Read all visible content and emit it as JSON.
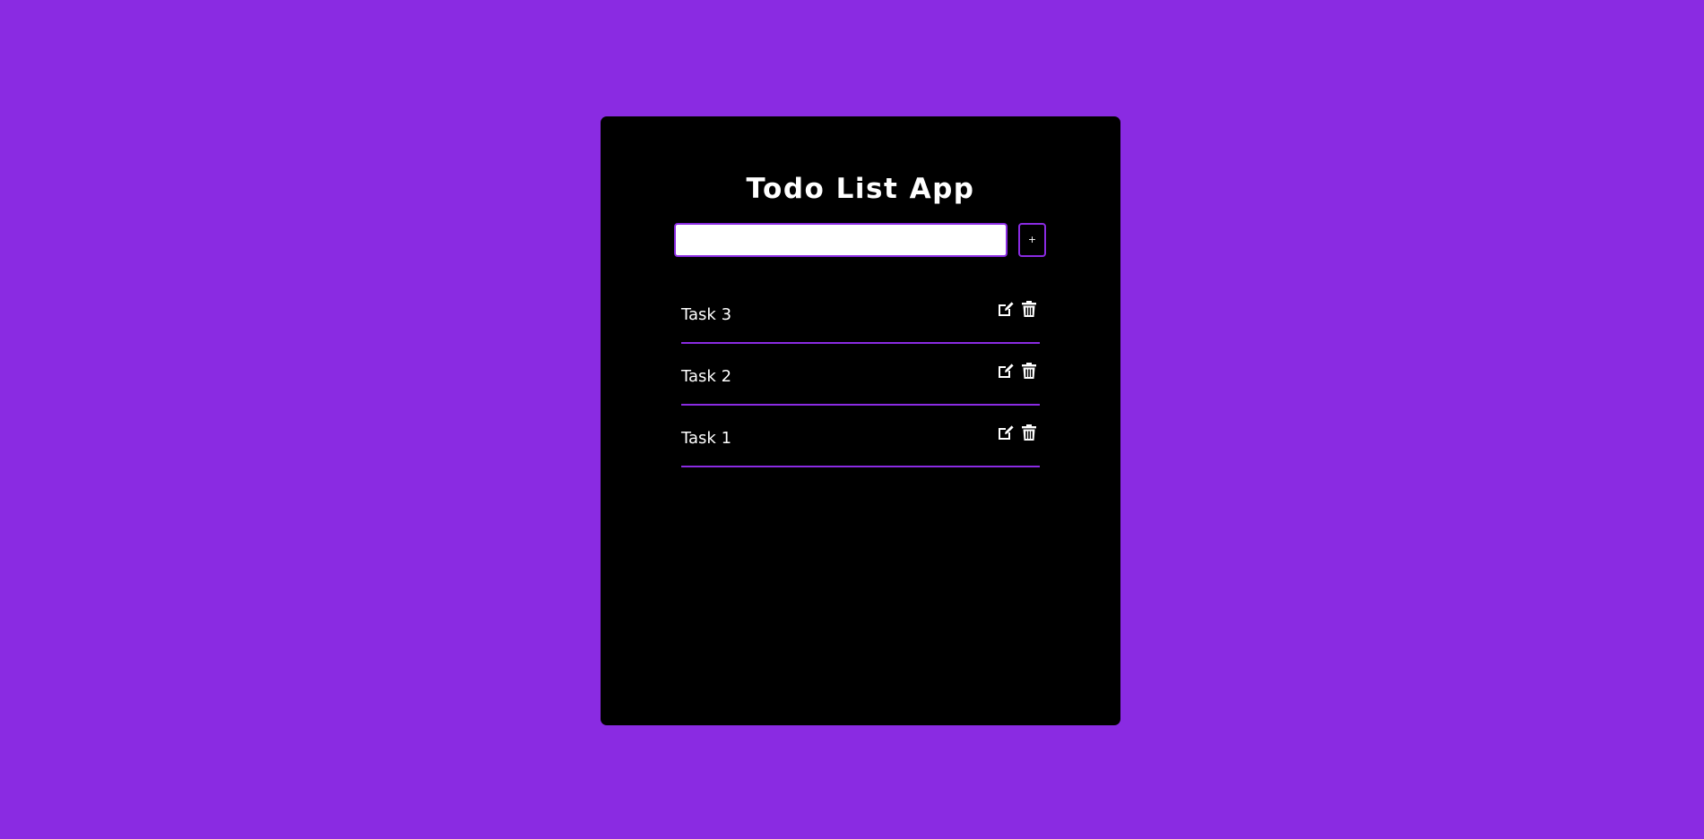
{
  "app": {
    "title": "Todo List App"
  },
  "input": {
    "value": "",
    "placeholder": ""
  },
  "add_button": {
    "label": "+"
  },
  "tasks": [
    {
      "text": "Task 3"
    },
    {
      "text": "Task 2"
    },
    {
      "text": "Task 1"
    }
  ],
  "icons": {
    "edit": "edit-icon",
    "delete": "trash-icon"
  },
  "colors": {
    "background": "#8a2be2",
    "card": "#000000",
    "accent": "#8a2be2",
    "text": "#ffffff"
  }
}
